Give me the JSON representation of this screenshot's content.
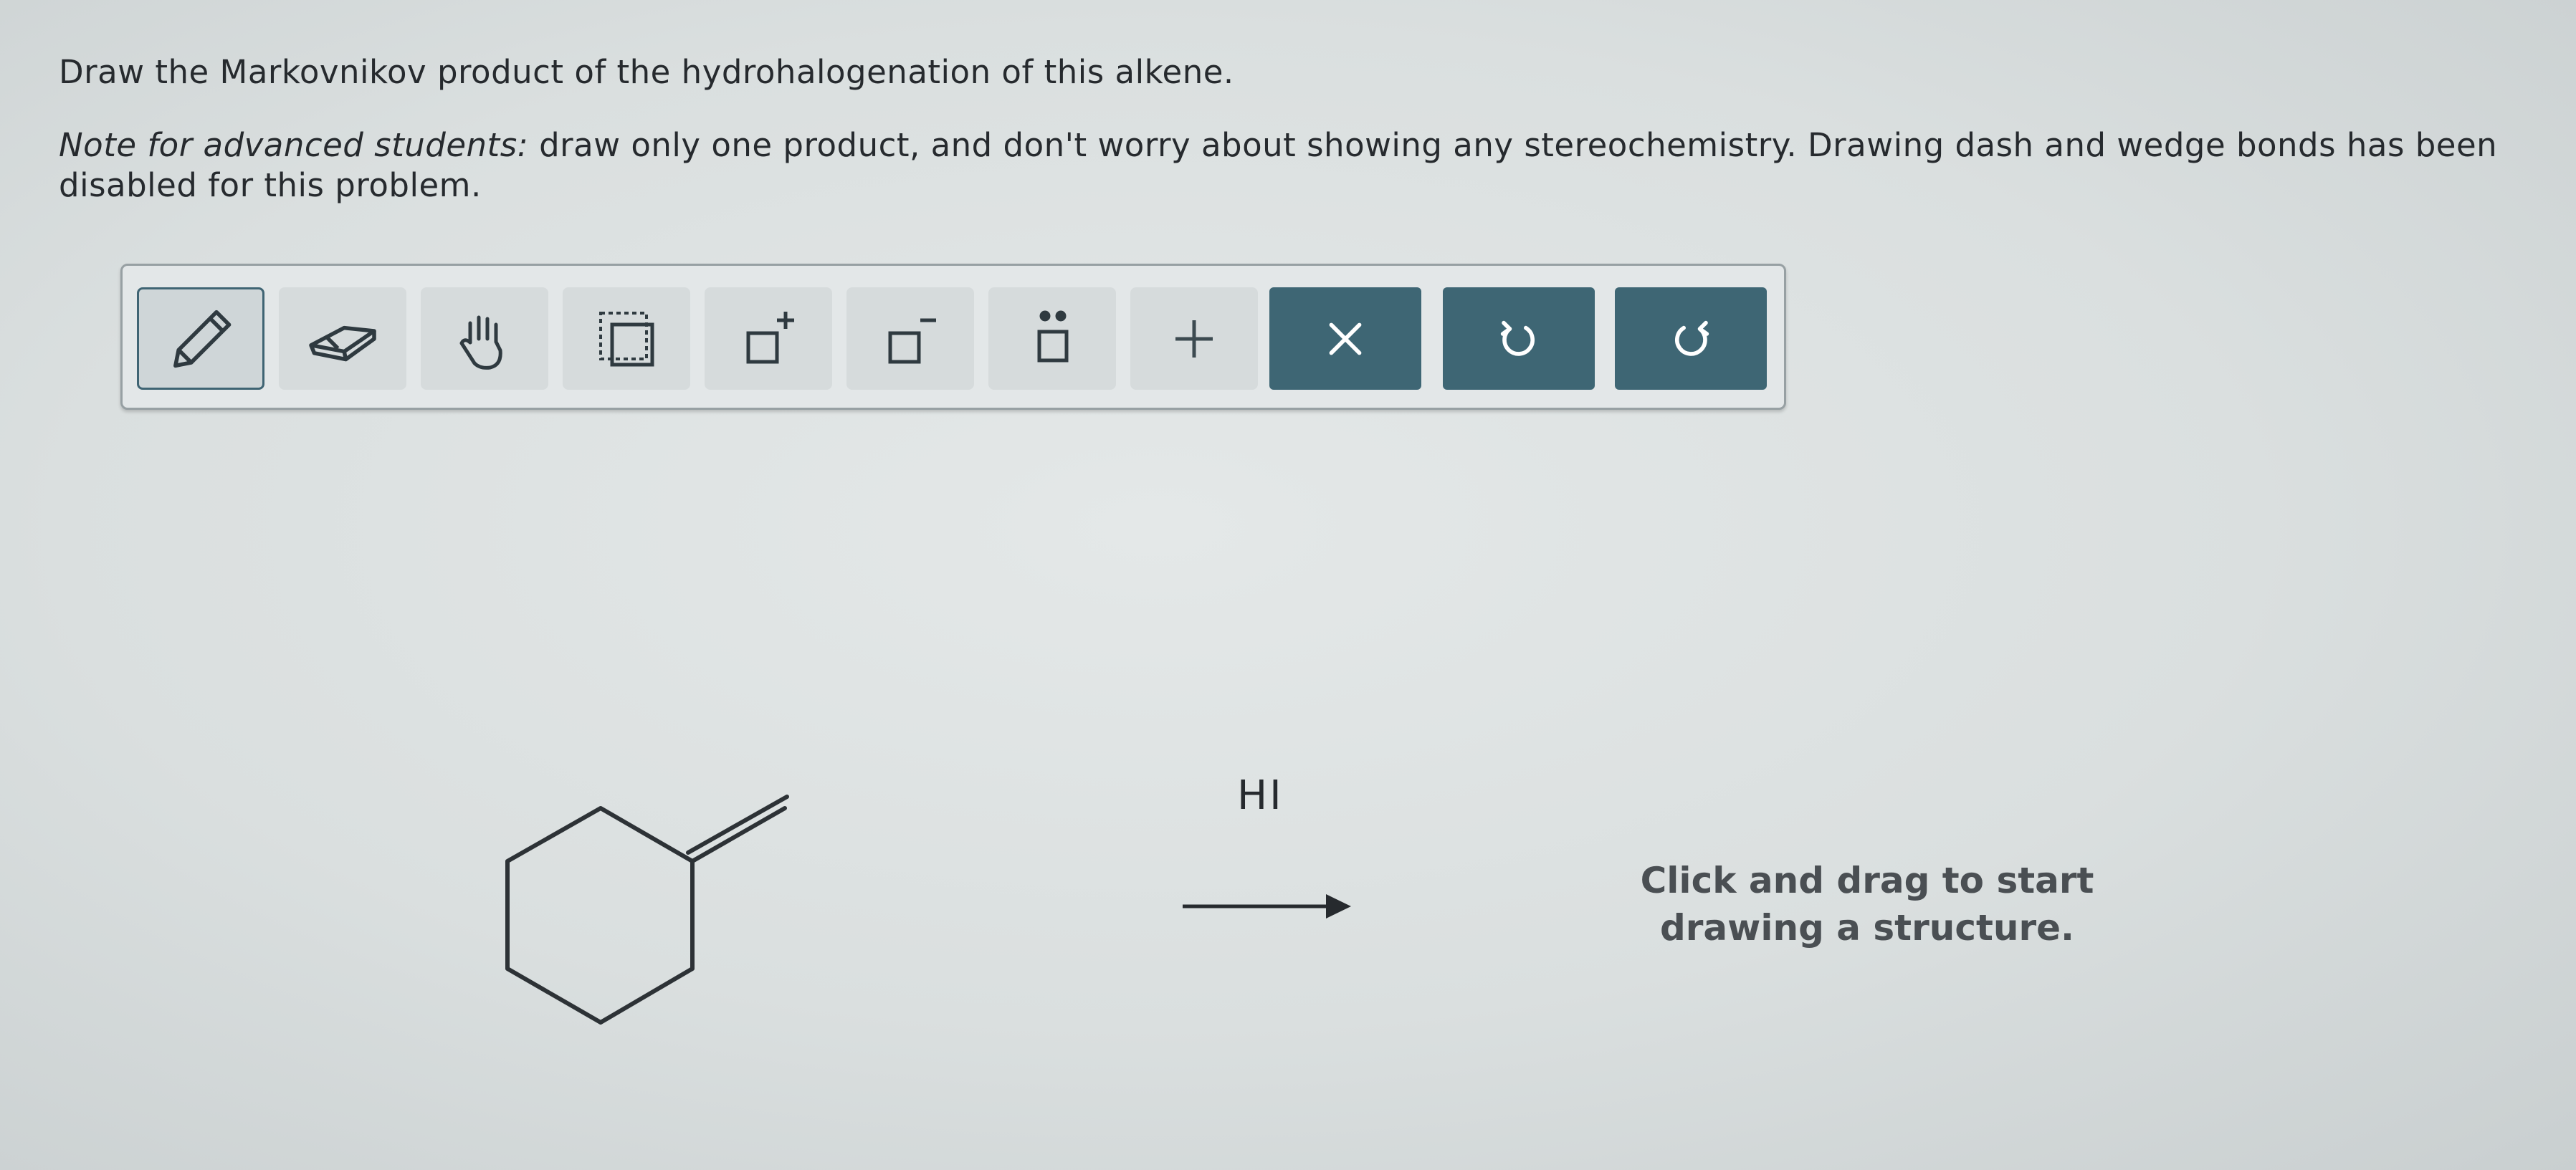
{
  "question": {
    "line1": "Draw the Markovnikov product of the hydrohalogenation of this alkene.",
    "note_label": "Note for advanced students:",
    "note_text": " draw only one product, and don't worry about showing any stereochemistry. Drawing dash and wedge bonds has been disabled for this problem."
  },
  "toolbar": {
    "tools": [
      {
        "icon": "pencil-icon",
        "active": true
      },
      {
        "icon": "eraser-icon"
      },
      {
        "icon": "hand-icon"
      },
      {
        "icon": "select-box-icon"
      },
      {
        "icon": "positive-charge-icon"
      },
      {
        "icon": "negative-charge-icon"
      },
      {
        "icon": "lone-pair-icon"
      },
      {
        "icon": "plus-icon"
      }
    ],
    "actions": [
      {
        "icon": "close-icon"
      },
      {
        "icon": "undo-icon"
      },
      {
        "icon": "redo-icon"
      }
    ],
    "accent_color": "#3e6674"
  },
  "reaction": {
    "reactant": "methylenecyclohexane",
    "reagent": "HI"
  },
  "answer_area": {
    "hint_line1": "Click and drag to start",
    "hint_line2": "drawing a structure."
  }
}
